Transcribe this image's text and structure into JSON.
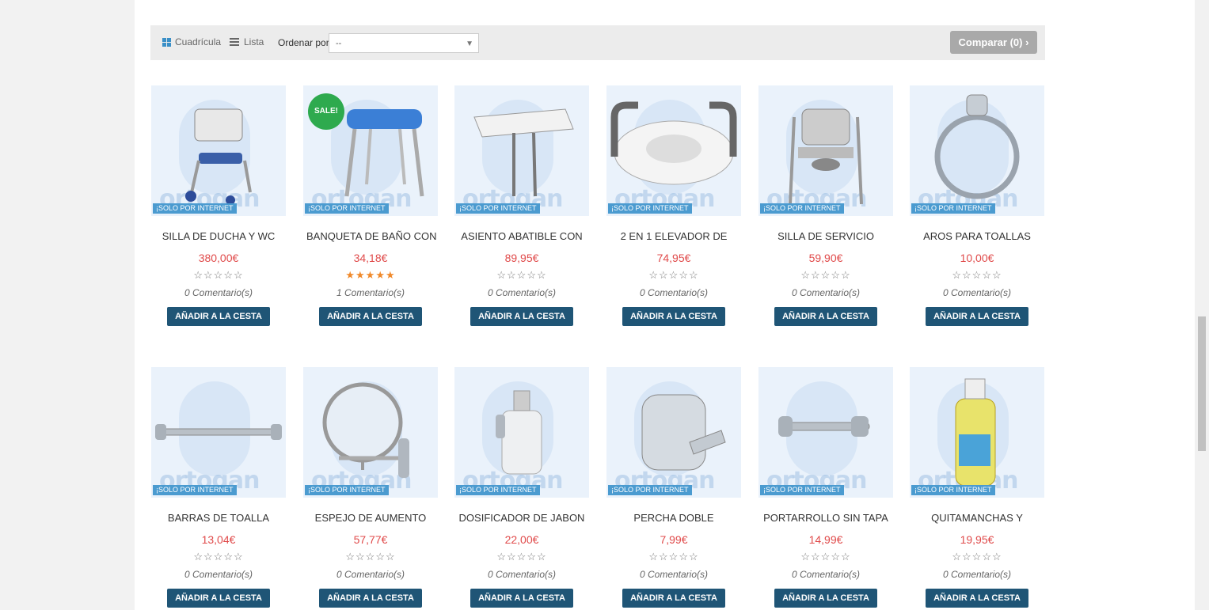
{
  "toolbar": {
    "grid_label": "Cuadrícula",
    "list_label": "Lista",
    "sort_label": "Ordenar por",
    "sort_value": "--",
    "compare_label": "Comparar (0)"
  },
  "products": [
    {
      "name": "SILLA DE DUCHA Y WC",
      "price": "380,00€",
      "stars": "☆☆☆☆☆",
      "rating": 0,
      "comments": "0 Comentario(s)",
      "badge": "¡SOLO POR INTERNET",
      "button": "AÑADIR A LA CESTA"
    },
    {
      "name": "BANQUETA DE BAÑO CON",
      "price": "34,18€",
      "stars": "★★★★★",
      "rating": 5,
      "comments": "1 Comentario(s)",
      "badge": "¡SOLO POR INTERNET",
      "sale": "SALE!",
      "button": "AÑADIR A LA CESTA"
    },
    {
      "name": "ASIENTO ABATIBLE CON",
      "price": "89,95€",
      "stars": "☆☆☆☆☆",
      "rating": 0,
      "comments": "0 Comentario(s)",
      "badge": "¡SOLO POR INTERNET",
      "button": "AÑADIR A LA CESTA"
    },
    {
      "name": "2 EN 1 ELEVADOR DE",
      "price": "74,95€",
      "stars": "☆☆☆☆☆",
      "rating": 0,
      "comments": "0 Comentario(s)",
      "badge": "¡SOLO POR INTERNET",
      "button": "AÑADIR A LA CESTA"
    },
    {
      "name": "SILLA DE SERVICIO",
      "price": "59,90€",
      "stars": "☆☆☆☆☆",
      "rating": 0,
      "comments": "0 Comentario(s)",
      "badge": "¡SOLO POR INTERNET",
      "button": "AÑADIR A LA CESTA"
    },
    {
      "name": "AROS PARA TOALLAS",
      "price": "10,00€",
      "stars": "☆☆☆☆☆",
      "rating": 0,
      "comments": "0 Comentario(s)",
      "badge": "¡SOLO POR INTERNET",
      "button": "AÑADIR A LA CESTA"
    },
    {
      "name": "BARRAS DE TOALLA",
      "price": "13,04€",
      "stars": "☆☆☆☆☆",
      "rating": 0,
      "comments": "0 Comentario(s)",
      "badge": "¡SOLO POR INTERNET",
      "button": "AÑADIR A LA CESTA"
    },
    {
      "name": "ESPEJO DE AUMENTO",
      "price": "57,77€",
      "stars": "☆☆☆☆☆",
      "rating": 0,
      "comments": "0 Comentario(s)",
      "badge": "¡SOLO POR INTERNET",
      "button": "AÑADIR A LA CESTA"
    },
    {
      "name": "DOSIFICADOR DE JABON",
      "price": "22,00€",
      "stars": "☆☆☆☆☆",
      "rating": 0,
      "comments": "0 Comentario(s)",
      "badge": "¡SOLO POR INTERNET",
      "button": "AÑADIR A LA CESTA"
    },
    {
      "name": "PERCHA DOBLE",
      "price": "7,99€",
      "stars": "☆☆☆☆☆",
      "rating": 0,
      "comments": "0 Comentario(s)",
      "badge": "¡SOLO POR INTERNET",
      "button": "AÑADIR A LA CESTA"
    },
    {
      "name": "PORTARROLLO SIN TAPA",
      "price": "14,99€",
      "stars": "☆☆☆☆☆",
      "rating": 0,
      "comments": "0 Comentario(s)",
      "badge": "¡SOLO POR INTERNET",
      "button": "AÑADIR A LA CESTA"
    },
    {
      "name": "QUITAMANCHAS Y",
      "price": "19,95€",
      "stars": "☆☆☆☆☆",
      "rating": 0,
      "comments": "0 Comentario(s)",
      "badge": "¡SOLO POR INTERNET",
      "button": "AÑADIR A LA CESTA"
    }
  ],
  "watermark": "ortogan",
  "colors": {
    "price": "#e04b4b",
    "button": "#1f5576",
    "badge": "#4b9bd0",
    "sale": "#2eaa4e",
    "star_filled": "#f0892a"
  }
}
